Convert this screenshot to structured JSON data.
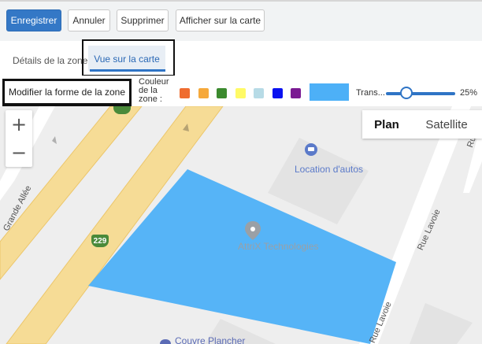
{
  "toolbar": {
    "save_label": "Enregistrer",
    "cancel_label": "Annuler",
    "delete_label": "Supprimer",
    "show_on_map_label": "Afficher sur la carte"
  },
  "tabs": [
    {
      "label": "Détails de la zone",
      "active": false
    },
    {
      "label": "Vue sur la carte",
      "active": true
    }
  ],
  "zone_controls": {
    "modify_shape_label": "Modifier la forme de la zone",
    "color_label_lines": [
      "Couleur",
      "de la",
      "zone :"
    ],
    "swatch_colors": [
      "#ef6c2f",
      "#f6a93b",
      "#3b8a2e",
      "#fffa66",
      "#b7dbe6",
      "#0a12f0",
      "#7a1a92"
    ],
    "selected_color": "#4db0f7",
    "transparency_label": "Trans...",
    "transparency_value": "25%",
    "transparency_fraction": 0.25
  },
  "map": {
    "zoom_in": "+",
    "zoom_out": "−",
    "map_types": [
      "Plan",
      "Satellite"
    ],
    "selected_map_type": "Plan",
    "zone_fill_color": "#4db0f7",
    "pois": [
      {
        "name": "Location d'autos",
        "color": "#5b7ac9",
        "icon": "car-rental-icon"
      },
      {
        "name": "AttriX Technologies",
        "color": "#9aa0a6",
        "icon": "map-pin-icon"
      },
      {
        "name": "Couvre Plancher",
        "color": "#5b6bb5",
        "icon": "map-pin-icon"
      }
    ],
    "road_labels": [
      "Grande Allée",
      "Rue Lavoie",
      "Rue Lavoie",
      "Rue L"
    ],
    "highway_shield": "229"
  }
}
